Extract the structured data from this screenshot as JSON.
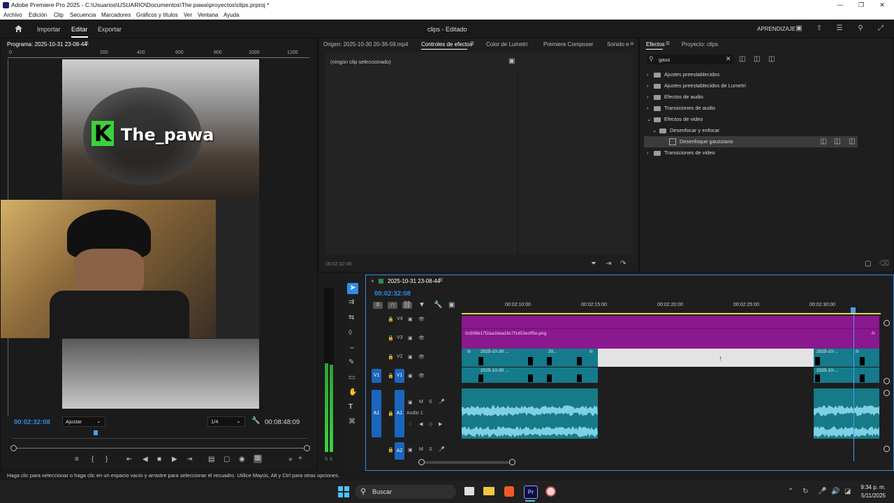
{
  "window": {
    "title": "Adobe Premiere Pro 2025 - C:\\Usuarios\\USUARIO\\Documentos\\The pawa\\proyectos\\clips.prproj *"
  },
  "menu": [
    "Archivo",
    "Edición",
    "Clip",
    "Secuencia",
    "Marcadores",
    "Gráficos y títulos",
    "Ver",
    "Ventana",
    "Ayuda"
  ],
  "header": {
    "import": "Importar",
    "edit": "Editar",
    "export": "Exportar",
    "project_status": "clips - Editado",
    "learning": "APRENDIZAJE"
  },
  "program": {
    "title": "Programa: 2025-10-31 23-08-44",
    "ruler": [
      "0",
      "200",
      "400",
      "600",
      "800",
      "1000",
      "1200"
    ],
    "overlay_name": "The_pawa",
    "overlay_letter": "K",
    "timecode": "00:02:32:08",
    "fit": "Ajustar",
    "resolution": "1/4",
    "duration": "00:08:48:09",
    "playhead_fraction": 0.28
  },
  "effect_controls": {
    "tabs": [
      "Origen: 2025-10-30 20-36-59.mp4",
      "Controles de efectos",
      "Color de Lumetri",
      "Premiere Composer",
      "Sonido e"
    ],
    "empty": "(ningún clip seleccionado)",
    "timecode": "00:02:32:08"
  },
  "effects": {
    "tabs": [
      "Efectos",
      "Proyecto: clips"
    ],
    "search": "gaus",
    "tree": [
      {
        "label": "Ajustes preestablecidos",
        "level": 0
      },
      {
        "label": "Ajustes preestablecidos de Lumetri",
        "level": 0
      },
      {
        "label": "Efectos de audio",
        "level": 0
      },
      {
        "label": "Transiciones de audio",
        "level": 0
      },
      {
        "label": "Efectos de video",
        "level": 0
      },
      {
        "label": "Desenfocar y enfocar",
        "level": 1
      },
      {
        "label": "Desenfoque gaussiano",
        "level": 2
      },
      {
        "label": "Transiciones de video",
        "level": 0
      }
    ]
  },
  "timeline": {
    "sequence": "2025-10-31 23-08-44",
    "timecode": "00:02:32:08",
    "ruler": [
      "00:02:10:00",
      "00:02:15:00",
      "00:02:20:00",
      "00:02:25:00",
      "00:02:30:00"
    ],
    "tracks": {
      "v4": "V4",
      "v3": "V3",
      "v2": "V2",
      "v1": "V1",
      "a1": "A1",
      "a1_name": "Audio 1",
      "a2": "A2"
    },
    "v3_clip": "0c506b17f2aa1bea16c7f1453ecff5e.png",
    "clip_names": [
      "2025-10-30 ...",
      "20...",
      "2025-10-...",
      "2025-10-30 ...",
      "2025-10-..."
    ],
    "fx": "fx"
  },
  "audio_meter": {
    "labels": [
      "S",
      "S"
    ]
  },
  "status": "Haga clic para seleccionar o haga clic en un espacio vacío y arrastre para seleccionar el recuadro. Utilice Mayús, Alt y Ctrl para otras opciones.",
  "taskbar": {
    "search": "Buscar",
    "time": "9:34 p. m.",
    "date": "5/11/2025",
    "app": "Pr"
  },
  "colors": {
    "accent": "#2d8ceb",
    "clip_purple": "#8a188e",
    "clip_teal": "#157a8a",
    "playhead": "#4a9ff5"
  }
}
